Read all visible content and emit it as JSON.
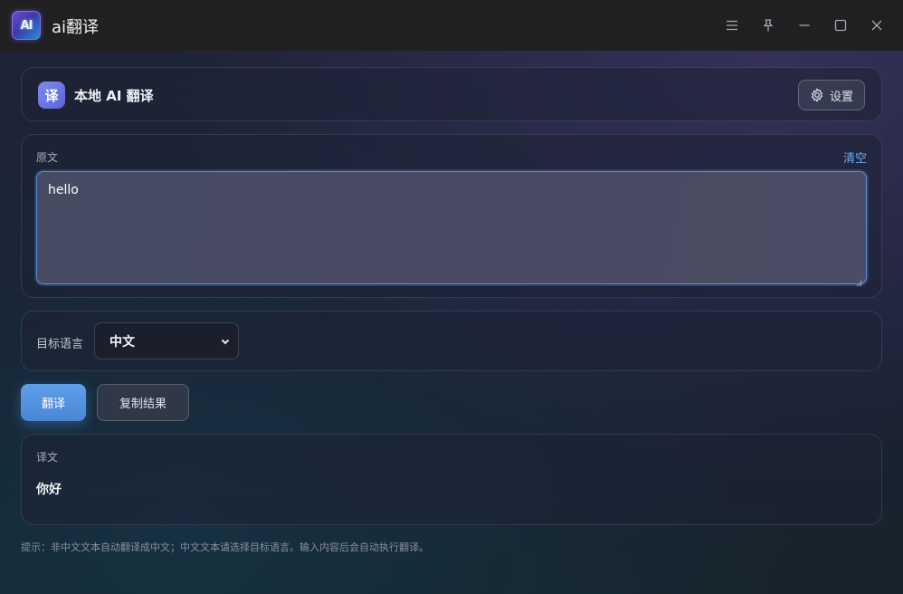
{
  "window": {
    "logo_text": "AI",
    "title": "ai翻译",
    "controls": [
      "menu-icon",
      "pin-icon",
      "minimize-icon",
      "maximize-icon",
      "close-icon"
    ]
  },
  "header": {
    "brand_icon_text": "译",
    "brand_title": "本地 AI 翻译",
    "settings_label": "设置"
  },
  "source": {
    "label": "原文",
    "clear_label": "清空",
    "value": "hello"
  },
  "language": {
    "label": "目标语言",
    "selected": "中文"
  },
  "actions": {
    "translate_label": "翻译",
    "copy_label": "复制结果"
  },
  "result": {
    "label": "译文",
    "text": "你好"
  },
  "hint": "提示：非中文文本自动翻译成中文；中文文本请选择目标语言。输入内容后会自动执行翻译。",
  "colors": {
    "accent": "#4a86d6",
    "link": "#6ea8f0",
    "titlebar": "#202022"
  }
}
